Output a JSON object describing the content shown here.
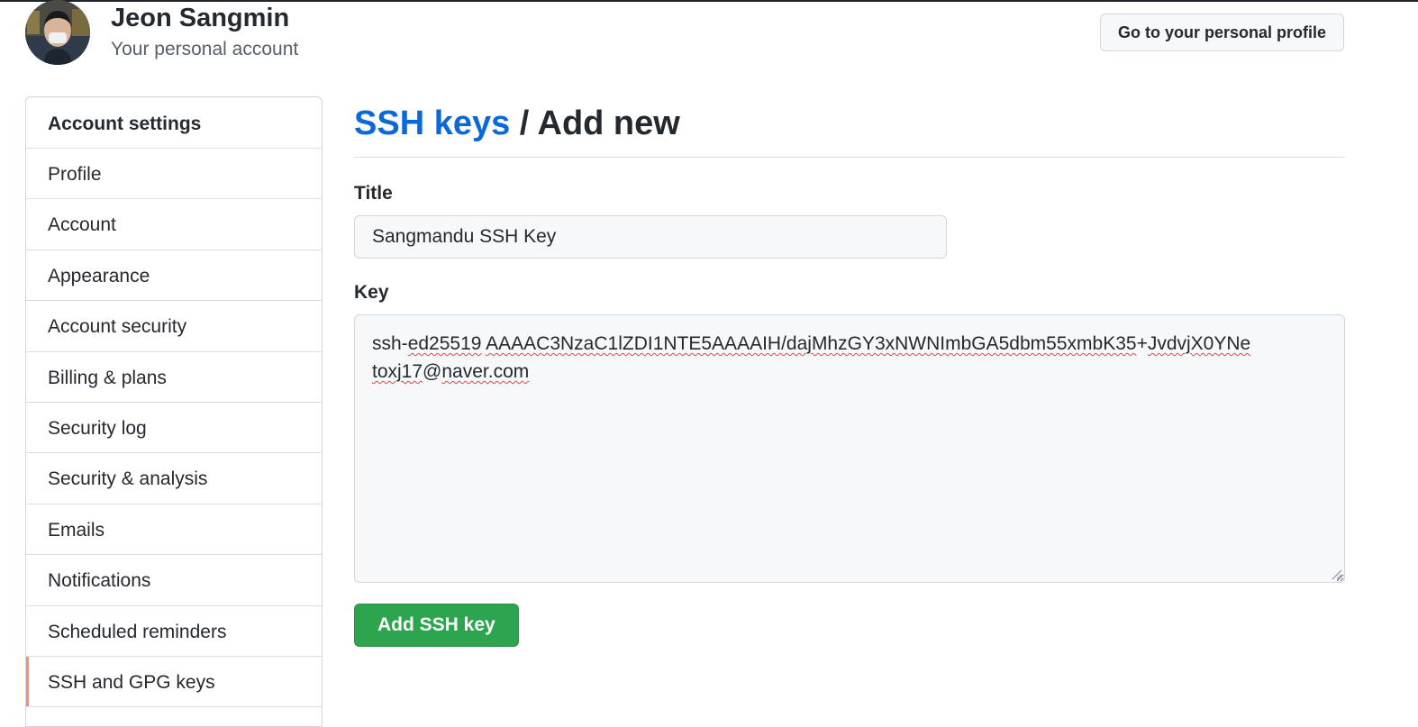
{
  "header": {
    "user_name": "Jeon Sangmin",
    "account_type": "Your personal account",
    "profile_button": "Go to your personal profile"
  },
  "sidebar": {
    "heading": "Account settings",
    "items": [
      {
        "label": "Profile"
      },
      {
        "label": "Account"
      },
      {
        "label": "Appearance"
      },
      {
        "label": "Account security"
      },
      {
        "label": "Billing & plans"
      },
      {
        "label": "Security log"
      },
      {
        "label": "Security & analysis"
      },
      {
        "label": "Emails"
      },
      {
        "label": "Notifications"
      },
      {
        "label": "Scheduled reminders"
      },
      {
        "label": "SSH and GPG keys",
        "active": true
      }
    ]
  },
  "main": {
    "breadcrumb_link": "SSH keys",
    "breadcrumb_rest": " / Add new",
    "title_label": "Title",
    "title_value": "Sangmandu SSH Key",
    "key_label": "Key",
    "key_line1_prefix": "ssh-",
    "key_line1_type": "ed25519",
    "key_line1_body": "AAAAC3NzaC1lZDI1NTE5AAAAIH/dajMhzGY3xNWNImbGA5dbm55xmbK35",
    "key_line1_plus": "+",
    "key_line1_tail": "JvdvjX0YNe",
    "key_line2_user": "toxj17",
    "key_line2_at": "@",
    "key_line2_domain": "naver.com",
    "submit_button": "Add SSH key"
  },
  "colors": {
    "link": "#0969da",
    "primary_button": "#2da44e",
    "active_indicator": "#fd8c73",
    "spellcheck": "#e5484d"
  }
}
